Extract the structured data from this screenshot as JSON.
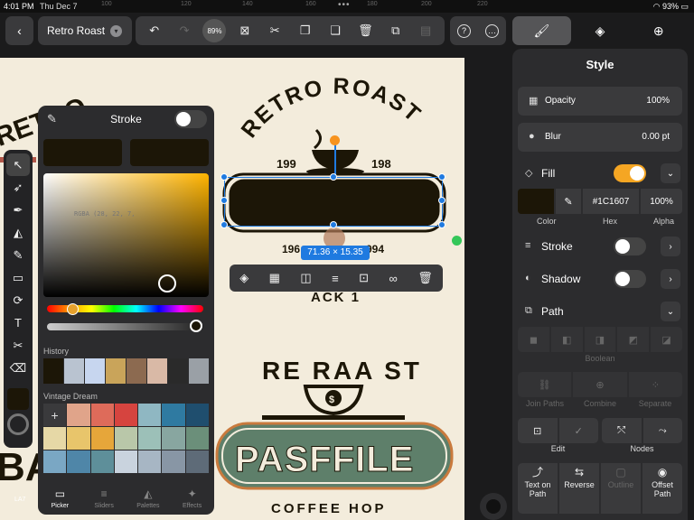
{
  "status": {
    "time": "4:01 PM",
    "date": "Thu Dec 7",
    "battery": "93%"
  },
  "ruler": {
    "ticks": [
      "100",
      "120",
      "140",
      "160",
      "180",
      "200",
      "220"
    ]
  },
  "toolbar": {
    "doc_title": "Retro Roast",
    "zoom": "89%"
  },
  "canvas": {
    "logo_top_text": "RETRO ROAST",
    "logo_top_year_left": "199",
    "logo_top_year_right": "198",
    "logo_top_bottom_left": "196",
    "logo_top_bottom_right": "994",
    "logo_top_arc_text": "ACK 1",
    "logo_bottom_arc": "RE RAA ST",
    "logo_bottom_banner": "PASFFILE",
    "logo_bottom_sub": "COFFEE HOP",
    "left_partial_text": "RETRO",
    "left_partial_bottom": "BA",
    "layer_label": "LA7",
    "selection_dimensions": "71.36 × 15.35"
  },
  "stroke_picker": {
    "title": "Stroke",
    "enabled": false,
    "sv_label": "RGBA (28, 22, 7,",
    "history_label": "History",
    "history_colors": [
      "#1c1607",
      "#b9c3d0",
      "#c7d6ef",
      "#c9a45a",
      "#8c6a50",
      "#d9b9a6",
      "#2a2a2a",
      "#9aa0a6"
    ],
    "palette_label": "Vintage Dream",
    "palette_colors": [
      "#3a3a3c",
      "#e0a48a",
      "#de6b5a",
      "#d6443f",
      "#8fb7c2",
      "#2f7aa1",
      "#1f4e6e",
      "#e6d8a6",
      "#e8c56b",
      "#e6a63a",
      "#b9c7a9",
      "#9cc0b8",
      "#88a6a0",
      "#6b8f7a",
      "#7aa7c4",
      "#4f86a8",
      "#5e8f9a",
      "#c9d3de",
      "#a7b6c4",
      "#8896a5",
      "#5e6b78"
    ],
    "add_symbol": "+",
    "tabs": [
      {
        "label": "Picker",
        "active": true
      },
      {
        "label": "Sliders",
        "active": false
      },
      {
        "label": "Palettes",
        "active": false
      },
      {
        "label": "Effects",
        "active": false
      }
    ]
  },
  "style_panel": {
    "title": "Style",
    "opacity_label": "Opacity",
    "opacity_value": "100%",
    "blur_label": "Blur",
    "blur_value": "0.00 pt",
    "fill_label": "Fill",
    "fill_enabled": true,
    "fill_color": "#1C1607",
    "fill_alpha": "100%",
    "color_label": "Color",
    "hex_label": "Hex",
    "alpha_label": "Alpha",
    "stroke_label": "Stroke",
    "shadow_label": "Shadow",
    "path_label": "Path",
    "boolean_label": "Boolean",
    "join_paths_label": "Join Paths",
    "combine_label": "Combine",
    "separate_label": "Separate",
    "edit_label": "Edit",
    "nodes_label": "Nodes",
    "text_on_path_label": "Text on Path",
    "reverse_label": "Reverse",
    "outline_label": "Outline",
    "offset_path_label": "Offset Path"
  },
  "colors": {
    "accent": "#1f7ae0",
    "toggle_on": "#f5a623",
    "fill_swatch": "#1c1607",
    "canvas_bg": "#f3ecdc"
  }
}
